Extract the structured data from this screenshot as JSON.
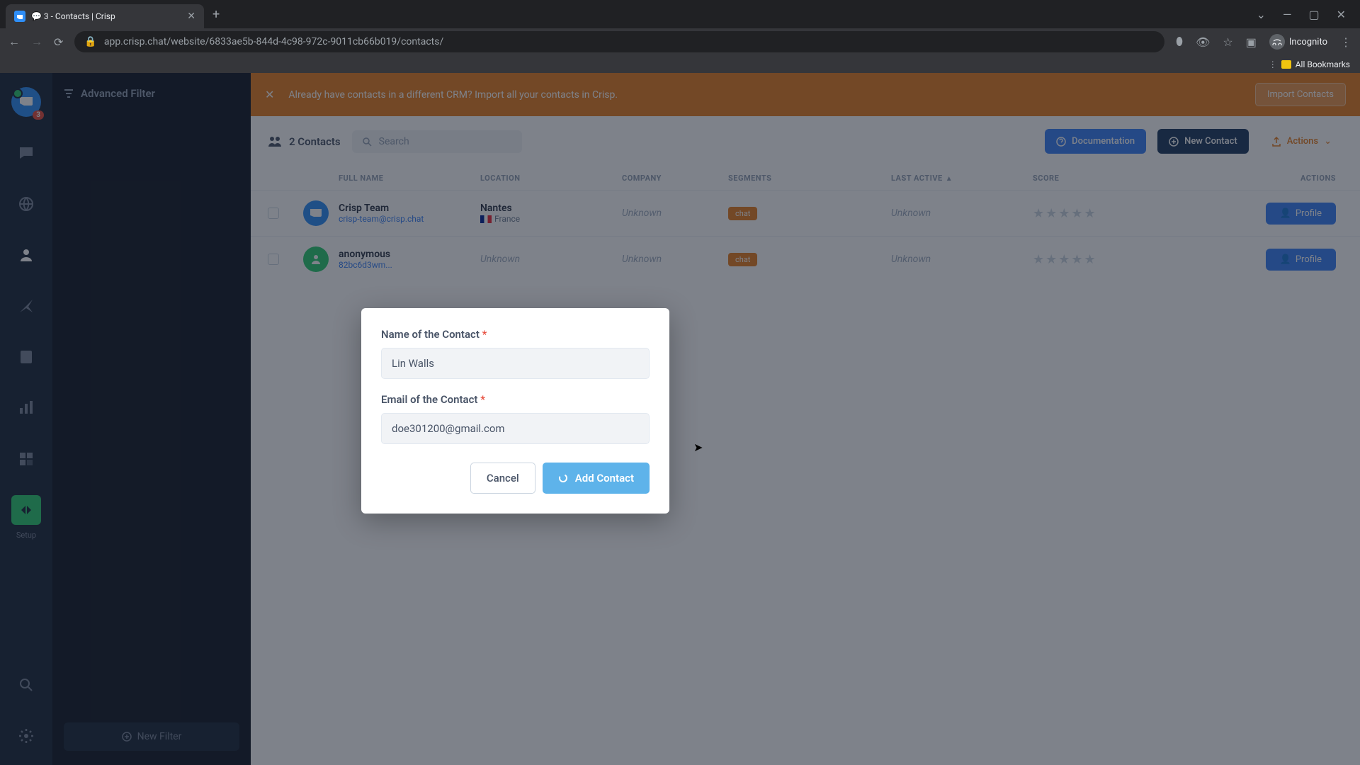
{
  "browser": {
    "tab_title": "💬 3 - Contacts | Crisp",
    "url": "app.crisp.chat/website/6833ae5b-844d-4c98-972c-9011cb66b019/contacts/",
    "incognito_label": "Incognito",
    "all_bookmarks": "All Bookmarks"
  },
  "rail": {
    "badge": "3",
    "setup_label": "Setup"
  },
  "filter_sidebar": {
    "title": "Advanced Filter",
    "new_filter": "New Filter"
  },
  "banner": {
    "text": "Already have contacts in a different CRM? Import all your contacts in Crisp.",
    "button": "Import Contacts"
  },
  "toolbar": {
    "count_label": "2 Contacts",
    "search_placeholder": "Search",
    "doc_label": "Documentation",
    "new_contact_label": "New Contact",
    "actions_label": "Actions"
  },
  "columns": {
    "full_name": "FULL NAME",
    "location": "LOCATION",
    "company": "COMPANY",
    "segments": "SEGMENTS",
    "last_active": "LAST ACTIVE",
    "score": "SCORE",
    "actions": "ACTIONS"
  },
  "rows": [
    {
      "name": "Crisp Team",
      "email": "crisp-team@crisp.chat",
      "city": "Nantes",
      "country": "France",
      "company": "Unknown",
      "segment": "chat",
      "last_active": "Unknown",
      "profile_btn": "Profile"
    },
    {
      "name": "anonymous",
      "email": "82bc6d3wm...",
      "city": "Unknown",
      "country": "",
      "company": "Unknown",
      "segment": "chat",
      "last_active": "Unknown",
      "profile_btn": "Profile"
    }
  ],
  "dialog": {
    "name_label": "Name of the Contact",
    "name_value": "Lin Walls",
    "email_label": "Email of the Contact",
    "email_value": "doe301200@gmail.com",
    "cancel": "Cancel",
    "submit": "Add Contact"
  }
}
